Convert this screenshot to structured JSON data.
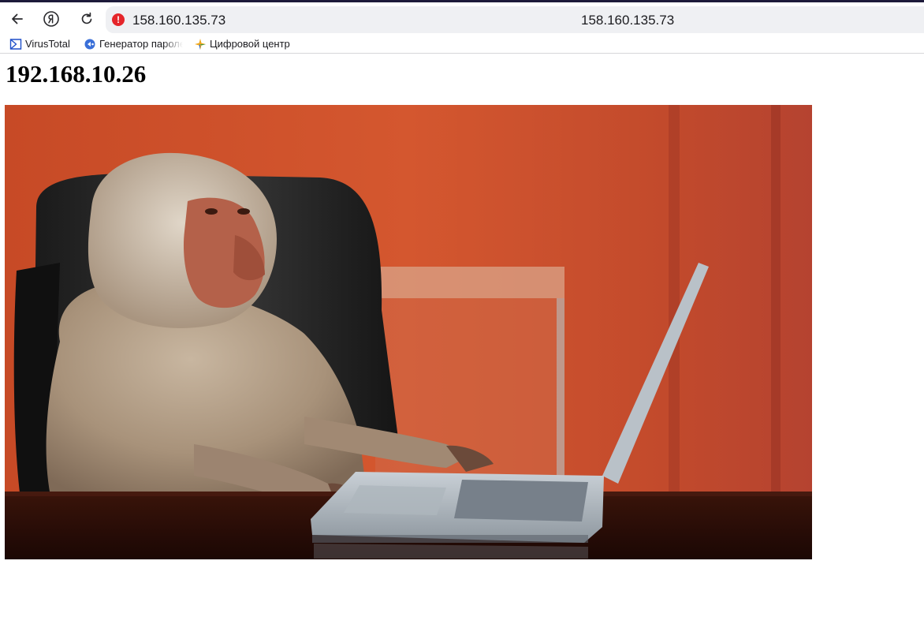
{
  "browser": {
    "toolbar": {
      "back_icon": "back-arrow-icon",
      "yandex_icon": "yandex-logo-icon",
      "reload_icon": "reload-icon",
      "security_icon": "not-secure-warning-icon",
      "security_glyph": "!",
      "address_text": "158.160.135.73",
      "page_title": "158.160.135.73"
    },
    "bookmarks": [
      {
        "label": "VirusTotal",
        "icon": "virustotal-icon"
      },
      {
        "label": "Генератор пароле",
        "icon": "password-generator-icon"
      },
      {
        "label": "Цифровой центр",
        "icon": "digital-center-icon"
      }
    ],
    "colors": {
      "accent_bar": "#1d1a3a",
      "warning": "#e5252a",
      "omnibox_bg": "#eff0f3"
    }
  },
  "page": {
    "heading": "192.168.10.26",
    "image": {
      "subject": "baboon-at-laptop-photo"
    }
  }
}
